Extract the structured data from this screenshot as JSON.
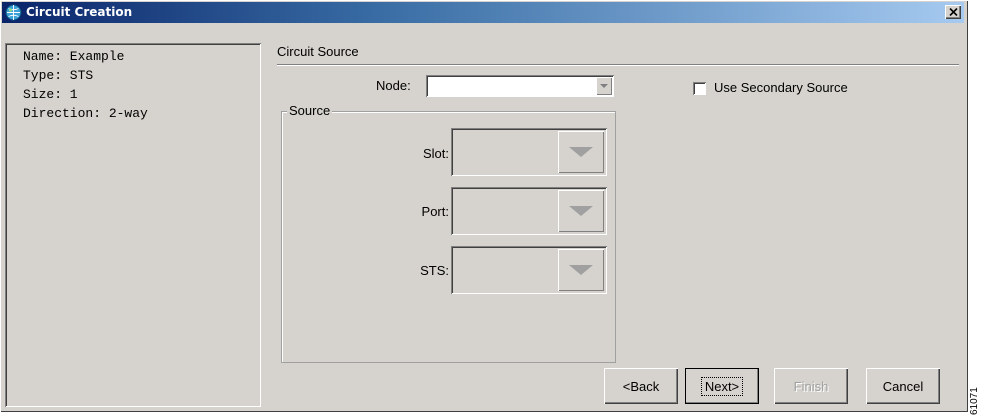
{
  "window": {
    "title": "Circuit Creation",
    "close_glyph": "×"
  },
  "summary": {
    "lines": [
      "Name: Example",
      "Type: STS",
      "Size: 1",
      "Direction: 2-way"
    ]
  },
  "circuit_source": {
    "section_title": "Circuit Source",
    "node_label": "Node:",
    "node_value": "",
    "use_secondary_label": "Use Secondary Source",
    "use_secondary_checked": false,
    "group_label": "Source",
    "slot_label": "Slot:",
    "port_label": "Port:",
    "sts_label": "STS:"
  },
  "buttons": {
    "back": "<Back",
    "next": "Next>",
    "finish": "Finish",
    "cancel": "Cancel"
  },
  "figure_id": "61071",
  "colors": {
    "window_bg": "#d6d3ce",
    "title_start": "#0a246a",
    "title_end": "#a6caf0"
  },
  "icons": [
    "app-globe-icon",
    "close-icon",
    "chevron-down-icon"
  ]
}
